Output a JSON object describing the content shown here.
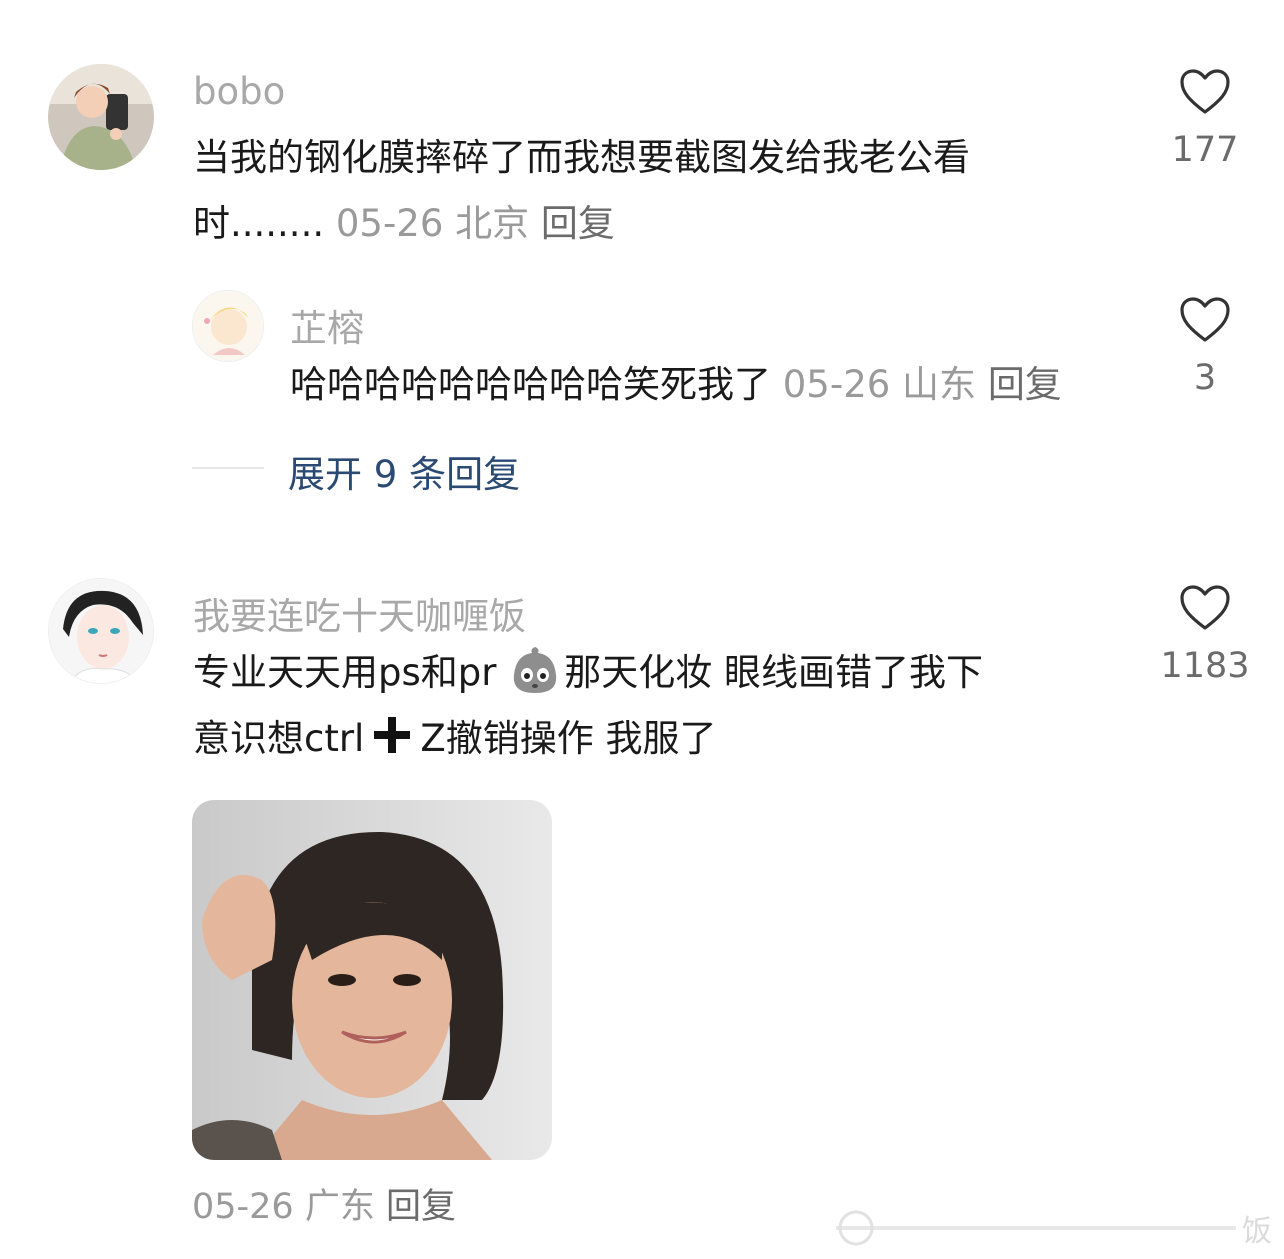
{
  "comments": [
    {
      "username": "bobo",
      "text_line1": "当我的钢化膜摔碎了而我想要截图发给我老公看",
      "text_line2": "时........",
      "date": "05-26",
      "location": "北京",
      "reply_label": "回复",
      "likes": "177"
    },
    {
      "username": "芷榕",
      "text": "哈哈哈哈哈哈哈哈哈笑死我了",
      "date": "05-26",
      "location": "山东",
      "reply_label": "回复",
      "likes": "3"
    },
    {
      "username": "我要连吃十天咖喱饭",
      "text_line1_a": "专业天天用ps和pr ",
      "text_line1_b": "那天化妆 眼线画错了我下",
      "text_line2_a": "意识想ctrl",
      "text_line2_b": "Z撤销操作 我服了",
      "date": "05-26",
      "location": "广东",
      "reply_label": "回复",
      "likes": "1183"
    }
  ],
  "expand_replies": "展开 9 条回复",
  "watermark": "饭",
  "icons": {
    "like": "heart-outline-icon",
    "emoji": "ghost-bag-emoji-icon",
    "plus": "heavy-plus-icon"
  },
  "colors": {
    "username": "#a8a8a8",
    "meta": "#9a9a9a",
    "expand": "#2a4a73",
    "text": "#1a1a1a"
  }
}
